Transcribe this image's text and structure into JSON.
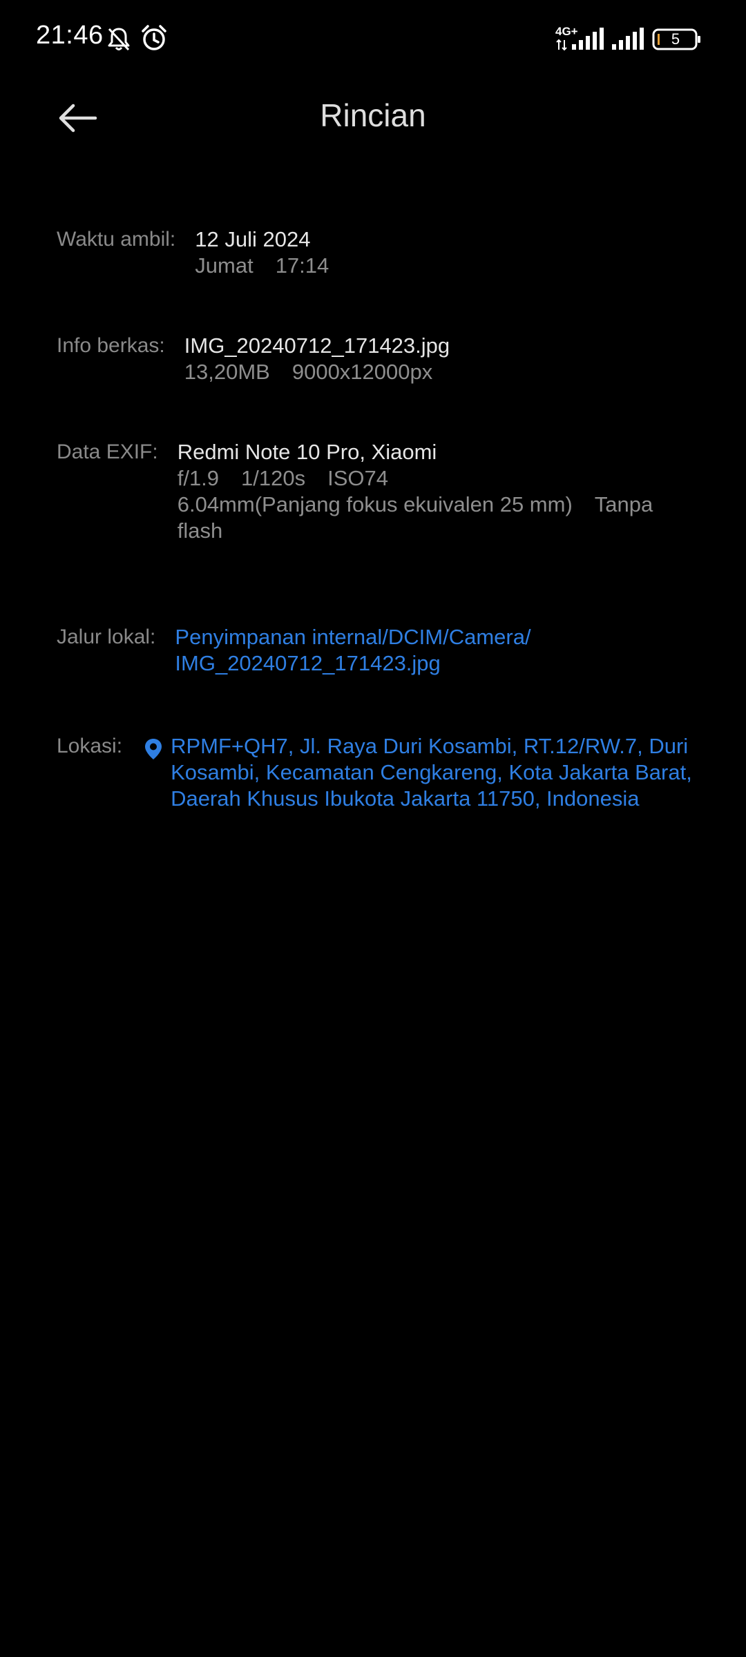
{
  "status_bar": {
    "time": "21:46",
    "network_type": "4G+",
    "battery_level": "5",
    "icons": [
      "bell-off-icon",
      "alarm-icon",
      "signal-icon",
      "signal-icon",
      "battery-icon"
    ]
  },
  "header": {
    "title": "Rincian",
    "back_icon": "arrow-left-icon"
  },
  "details": {
    "time": {
      "label": "Waktu ambil:",
      "date": "12 Juli 2024",
      "day": "Jumat",
      "clock": "17:14"
    },
    "file": {
      "label": "Info berkas:",
      "name": "IMG_20240712_171423.jpg",
      "size": "13,20MB",
      "resolution": "9000x12000px"
    },
    "exif": {
      "label": "Data EXIF:",
      "device": "Redmi Note 10 Pro, Xiaomi",
      "aperture": "f/1.9",
      "shutter": "1/120s",
      "iso": "ISO74",
      "focal": "6.04mm(Panjang fokus ekuivalen 25 mm)",
      "flash": "Tanpa flash"
    },
    "path": {
      "label": "Jalur lokal:",
      "line1": "Penyimpanan internal/DCIM/Camera/",
      "line2": "IMG_20240712_171423.jpg"
    },
    "location": {
      "label": "Lokasi:",
      "icon": "location-pin-icon",
      "address": "RPMF+QH7, Jl. Raya Duri Kosambi, RT.12/RW.7, Duri Kosambi, Kecamatan Cengkareng, Kota Jakarta Barat, Daerah Khusus Ibukota Jakarta 11750, Indonesia"
    }
  },
  "colors": {
    "background": "#000000",
    "label": "#8a8a8a",
    "primary_text": "#e6e6e6",
    "secondary_text": "#8e8e8e",
    "link": "#2f7fe3"
  }
}
